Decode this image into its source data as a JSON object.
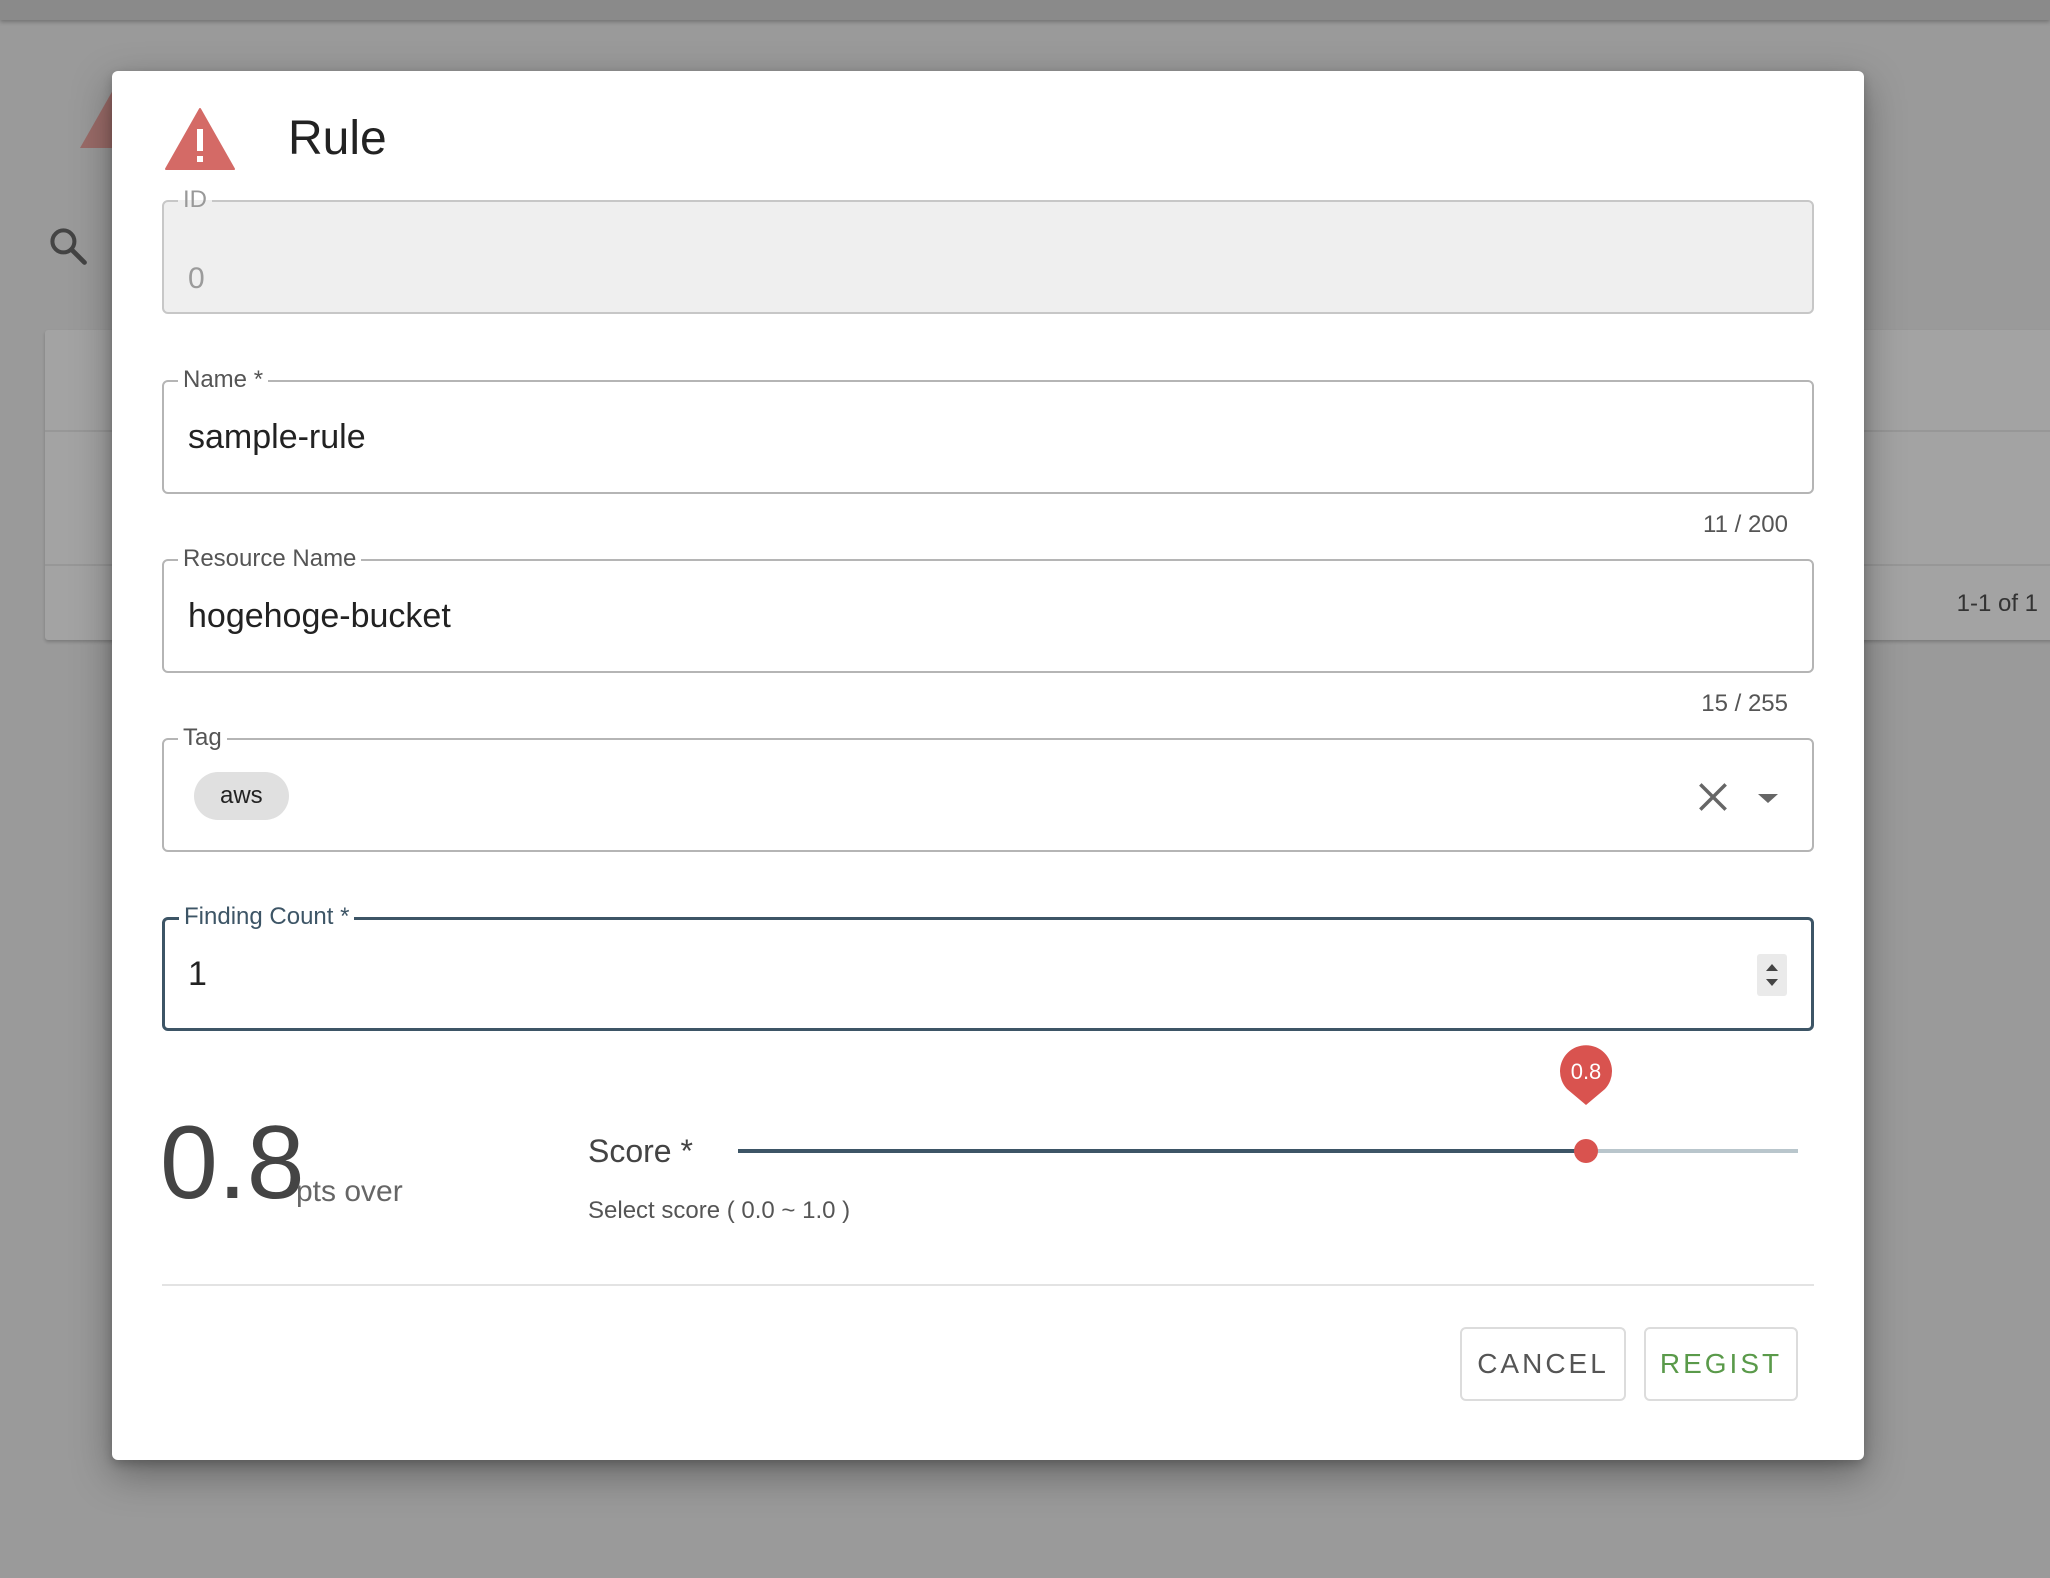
{
  "dialog": {
    "title": "Rule",
    "icon": "warning-icon",
    "accent_color": "#d9534f"
  },
  "fields": {
    "id": {
      "label": "ID",
      "value": "0",
      "disabled": true
    },
    "name": {
      "label": "Name *",
      "value": "sample-rule",
      "counter": "11 / 200"
    },
    "resource_name": {
      "label": "Resource Name",
      "value": "hogehoge-bucket",
      "counter": "15 / 255"
    },
    "tag": {
      "label": "Tag",
      "chips": [
        "aws"
      ]
    },
    "finding_count": {
      "label": "Finding Count *",
      "value": "1"
    }
  },
  "score": {
    "display_value": "0.8",
    "suffix": "pts over",
    "label": "Score *",
    "hint": "Select score ( 0.0 ~ 1.0 )",
    "value": 0.8,
    "min": 0.0,
    "max": 1.0,
    "bubble_label": "0.8"
  },
  "actions": {
    "cancel_label": "CANCEL",
    "regist_label": "REGIST"
  },
  "background": {
    "pagination": "1-1 of 1"
  },
  "colors": {
    "slider_active": "#3d5566",
    "slider_thumb": "#d9534f",
    "regist_text": "#5a9a4a"
  }
}
